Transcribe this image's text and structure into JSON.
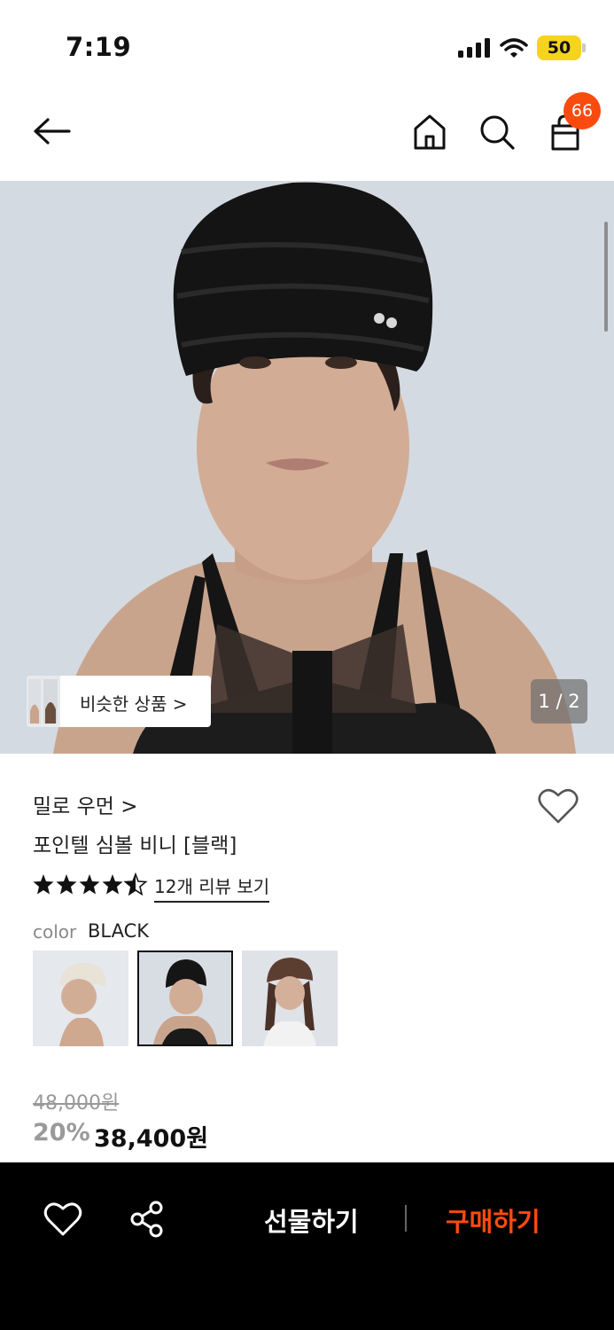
{
  "status_bar": {
    "time": "7:19",
    "battery": "50",
    "battery_color": "#f6d31d"
  },
  "header": {
    "icons": [
      "arrow-left-icon",
      "home-icon",
      "search-icon",
      "shopping-bag-icon"
    ],
    "cart_count": "66",
    "badge_color": "#fa4b0f"
  },
  "gallery": {
    "similar_label": "비슷한 상품 >",
    "page_indicator": "1 / 2"
  },
  "product": {
    "brand": "밀로 우먼 >",
    "title": "포인텔 심볼 비니 [블랙]",
    "rating": 4.5,
    "review_link": "12개 리뷰 보기",
    "color_label": "color",
    "color_value": "BLACK",
    "color_options": [
      "ivory",
      "black",
      "brown"
    ],
    "selected_color": "black",
    "original_price": "48,000원",
    "discount": "20%",
    "sale_price": "38,400원"
  },
  "bottom_bar": {
    "gift_label": "선물하기",
    "buy_label": "구매하기",
    "buy_color": "#fa4b0f",
    "icons": [
      "heart-icon",
      "share-icon"
    ]
  }
}
